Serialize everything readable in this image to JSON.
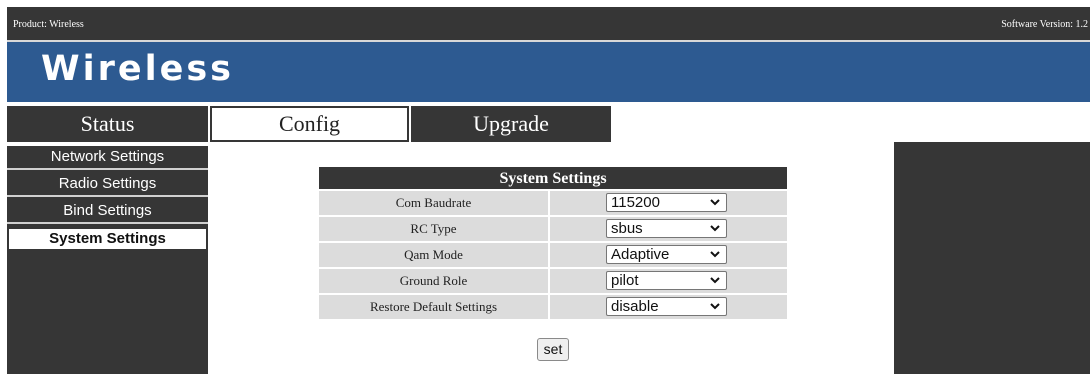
{
  "topbar": {
    "product": "Product:  Wireless",
    "software_version": "Software Version:  1.2"
  },
  "banner": {
    "brand": "Wireless"
  },
  "nav": {
    "tabs": [
      {
        "label": "Status",
        "active": false
      },
      {
        "label": "Config",
        "active": true
      },
      {
        "label": "Upgrade",
        "active": false
      }
    ]
  },
  "sidebar": {
    "items": [
      {
        "label": "Network Settings",
        "active": false
      },
      {
        "label": "Radio Settings",
        "active": false
      },
      {
        "label": "Bind Settings",
        "active": false
      },
      {
        "label": "System Settings",
        "active": true
      }
    ]
  },
  "settings": {
    "title": "System Settings",
    "rows": [
      {
        "label": "Com Baudrate",
        "value": "115200"
      },
      {
        "label": "RC Type",
        "value": "sbus"
      },
      {
        "label": "Qam Mode",
        "value": "Adaptive"
      },
      {
        "label": "Ground Role",
        "value": "pilot"
      },
      {
        "label": "Restore Default Settings",
        "value": "disable"
      }
    ],
    "set_label": "set"
  },
  "colors": {
    "topbar": "#363636",
    "banner": "#2d5a91",
    "sidebar": "#363636",
    "row_background": "#dcdcdc"
  },
  "icons": {
    "select_arrow": "chevron-down-icon"
  }
}
